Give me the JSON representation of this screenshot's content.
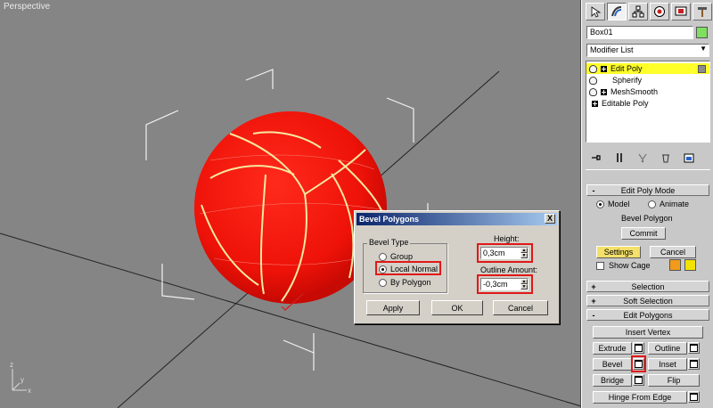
{
  "viewport": {
    "label": "Perspective"
  },
  "panel": {
    "tabs": [
      {
        "icon": "create-cursor-icon"
      },
      {
        "icon": "modify-icon",
        "active": true
      },
      {
        "icon": "hierarchy-icon"
      },
      {
        "icon": "motion-icon"
      },
      {
        "icon": "display-icon"
      },
      {
        "icon": "utilities-hammer-icon"
      }
    ],
    "object_name": "Box01",
    "object_color": "#7fe060",
    "modifier_list": "Modifier List",
    "stack": [
      {
        "label": "Edit Poly",
        "bulb": true,
        "expand": true,
        "selected": true
      },
      {
        "label": "Spherify",
        "bulb": true,
        "expand": false,
        "selected": false
      },
      {
        "label": "MeshSmooth",
        "bulb": true,
        "expand": true,
        "selected": false
      },
      {
        "label": "Editable Poly",
        "bulb": false,
        "expand": true,
        "selected": false
      }
    ],
    "edit_poly_mode": {
      "title": "Edit Poly Mode",
      "sign": "-",
      "model": "Model",
      "animate": "Animate",
      "operation": "Bevel Polygon",
      "commit": "Commit",
      "settings": "Settings",
      "cancel": "Cancel",
      "show_cage": "Show Cage",
      "cage_color_1": "#f29a1a",
      "cage_color_2": "#f2e200"
    },
    "selection": {
      "title": "Selection",
      "sign": "+"
    },
    "soft_selection": {
      "title": "Soft Selection",
      "sign": "+"
    },
    "edit_polygons": {
      "title": "Edit Polygons",
      "sign": "-",
      "insert_vertex": "Insert Vertex",
      "extrude": "Extrude",
      "outline": "Outline",
      "bevel": "Bevel",
      "inset": "Inset",
      "bridge": "Bridge",
      "flip": "Flip",
      "hinge": "Hinge From Edge"
    }
  },
  "dialog": {
    "title": "Bevel Polygons",
    "close": "X",
    "bevel_type": {
      "title": "Bevel Type",
      "options": [
        "Group",
        "Local Normal",
        "By Polygon"
      ],
      "selected": "Local Normal"
    },
    "height": {
      "label": "Height:",
      "value": "0,3cm"
    },
    "outline": {
      "label": "Outline Amount:",
      "value": "-0,3cm"
    },
    "apply": "Apply",
    "ok": "OK",
    "cancel": "Cancel"
  }
}
